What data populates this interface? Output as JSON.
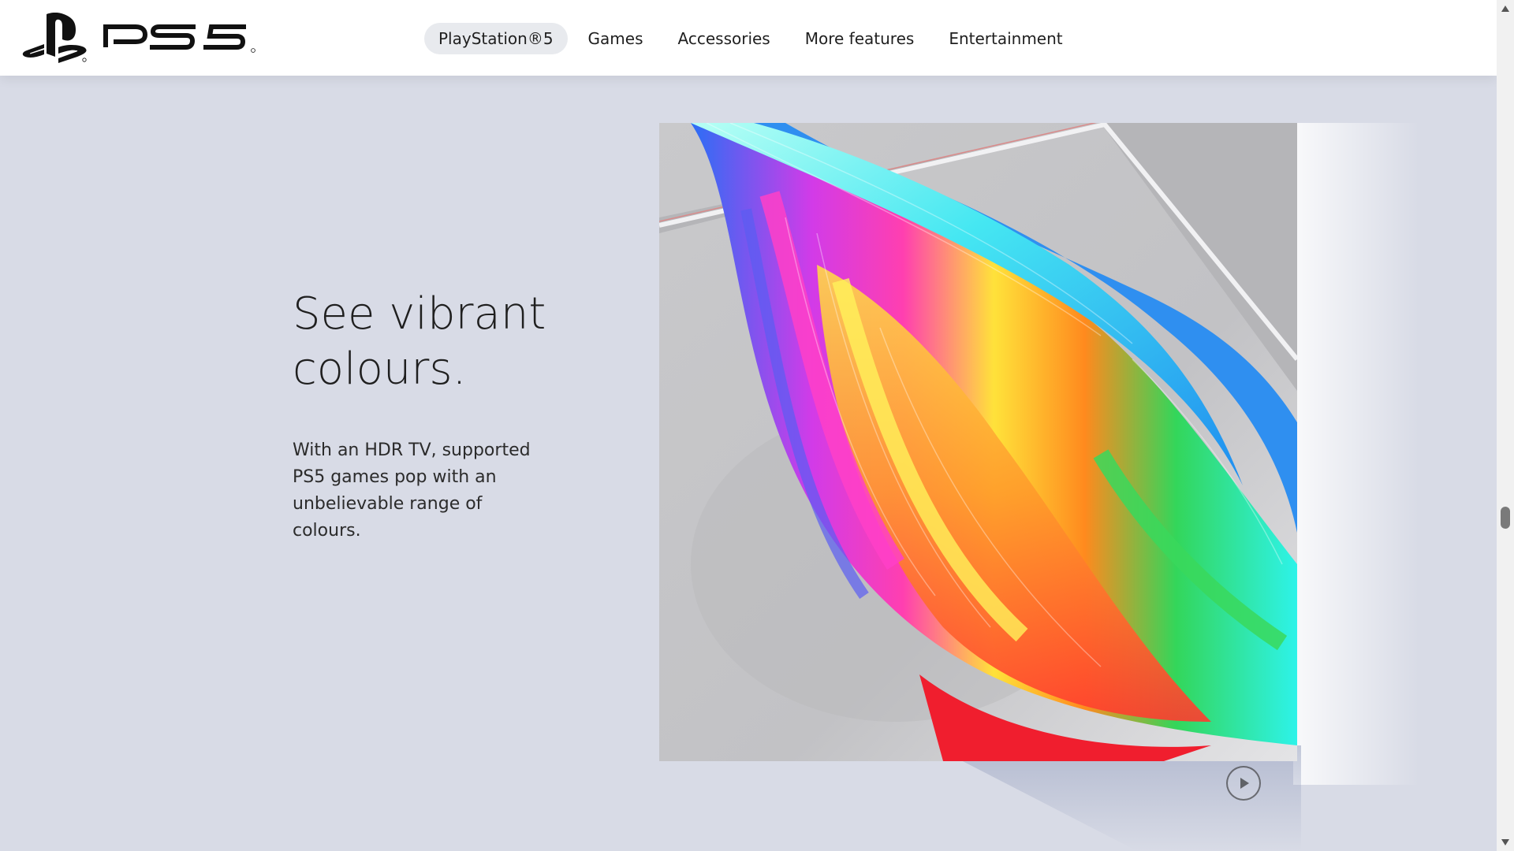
{
  "header": {
    "logo_text": "PS5",
    "nav": [
      {
        "label": "PlayStation®5",
        "active": true
      },
      {
        "label": "Games",
        "active": false
      },
      {
        "label": "Accessories",
        "active": false
      },
      {
        "label": "More features",
        "active": false
      },
      {
        "label": "Entertainment",
        "active": false
      }
    ]
  },
  "feature": {
    "title": "See vibrant colours.",
    "description": "With an HDR TV, supported PS5 games pop with an unbelievable range of colours.",
    "media_icon": "play-circle-icon"
  },
  "colors": {
    "background": "#d8dbe6",
    "header_bg": "#ffffff",
    "active_pill": "#e8eaee",
    "text": "#1f1f1f"
  }
}
